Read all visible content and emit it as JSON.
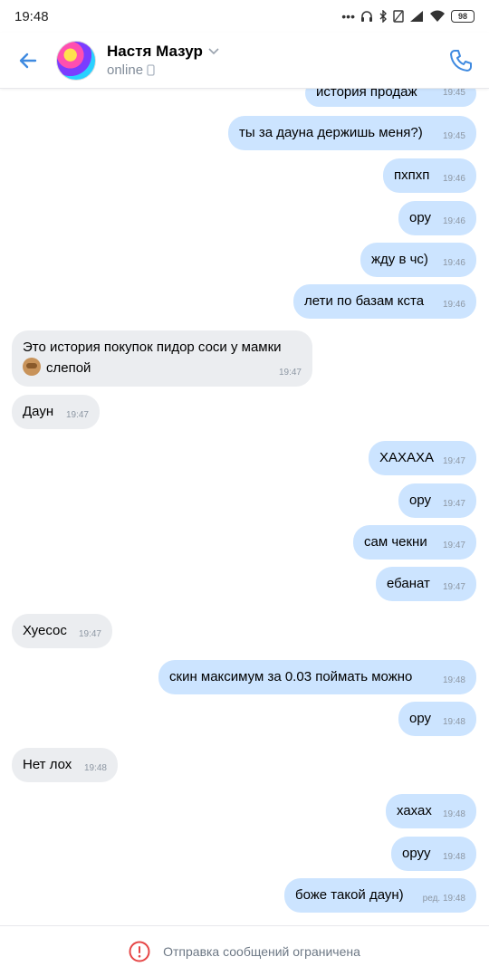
{
  "status_bar": {
    "time": "19:48",
    "dots": "•••",
    "battery": "98"
  },
  "header": {
    "name": "Настя Мазур",
    "status": "online"
  },
  "messages": [
    {
      "dir": "out",
      "text": "история продаж",
      "time": "19:45"
    },
    {
      "dir": "out",
      "text": "ты за дауна держишь меня?)",
      "time": "19:45"
    },
    {
      "dir": "out",
      "text": "пхпхп",
      "time": "19:46"
    },
    {
      "dir": "out",
      "text": "ору",
      "time": "19:46"
    },
    {
      "dir": "out",
      "text": "жду в чс)",
      "time": "19:46"
    },
    {
      "dir": "out",
      "text": "лети по базам кста",
      "time": "19:46"
    },
    {
      "dir": "in",
      "text": "Это история покупок пидор соси у мамки",
      "text2": "слепой",
      "emoji": "see-no-evil-monkey-emoji",
      "time": "19:47"
    },
    {
      "dir": "in",
      "text": "Даун",
      "time": "19:47"
    },
    {
      "dir": "out",
      "text": "ХАХАХА",
      "time": "19:47"
    },
    {
      "dir": "out",
      "text": "ору",
      "time": "19:47"
    },
    {
      "dir": "out",
      "text": "сам чекни",
      "time": "19:47"
    },
    {
      "dir": "out",
      "text": "ебанат",
      "time": "19:47"
    },
    {
      "dir": "in",
      "text": "Хуесос",
      "time": "19:47"
    },
    {
      "dir": "out",
      "text": "скин максимум за 0.03 поймать можно",
      "time": "19:48"
    },
    {
      "dir": "out",
      "text": "ору",
      "time": "19:48"
    },
    {
      "dir": "in",
      "text": "Нет лох",
      "time": "19:48"
    },
    {
      "dir": "out",
      "text": "хахах",
      "time": "19:48"
    },
    {
      "dir": "out",
      "text": "оруу",
      "time": "19:48"
    },
    {
      "dir": "out",
      "text": "боже такой даун)",
      "time": "ред. 19:48"
    }
  ],
  "footer": {
    "text": "Отправка сообщений ограничена"
  },
  "colors": {
    "accent": "#3f8ae0",
    "outgoing_bubble": "#cce4ff",
    "incoming_bubble": "#ebedf0",
    "warning": "#e64646"
  }
}
